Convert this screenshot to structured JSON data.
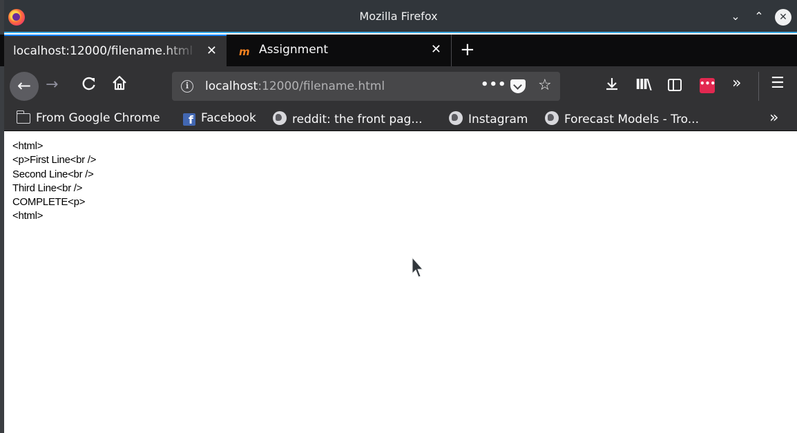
{
  "window": {
    "title": "Mozilla Firefox",
    "controls": {
      "minimize": "⌄",
      "maximize": "⌃",
      "close": "✕"
    }
  },
  "tabs": [
    {
      "label": "localhost:12000/filename.html",
      "close": "✕",
      "active": true
    },
    {
      "label": "Assignment",
      "favicon": "m",
      "close": "✕",
      "active": false
    }
  ],
  "new_tab_label": "+",
  "navbar": {
    "back": "←",
    "forward": "→",
    "reload": "C",
    "home": "⌂",
    "url_host": "localhost",
    "url_rest": ":12000/filename.html",
    "page_actions": "•••",
    "bookmark_star": "☆",
    "download": "⤓",
    "library": "III\\",
    "overflow": "»",
    "extension": "•••",
    "menu": "☰"
  },
  "bookmarks": [
    {
      "label": "From Google Chrome",
      "icon": "folder-icon"
    },
    {
      "label": "Facebook",
      "icon": "facebook-icon"
    },
    {
      "label": "reddit: the front pag...",
      "icon": "globe-icon"
    },
    {
      "label": "Instagram",
      "icon": "globe-icon"
    },
    {
      "label": "Forecast Models - Tro...",
      "icon": "globe-icon"
    }
  ],
  "bookmarks_more": "»",
  "page": {
    "lines": [
      "<html>",
      "<p>First Line<br />",
      "Second Line<br />",
      "Third Line<br />",
      "COMPLETE<p>",
      "<html>"
    ]
  }
}
